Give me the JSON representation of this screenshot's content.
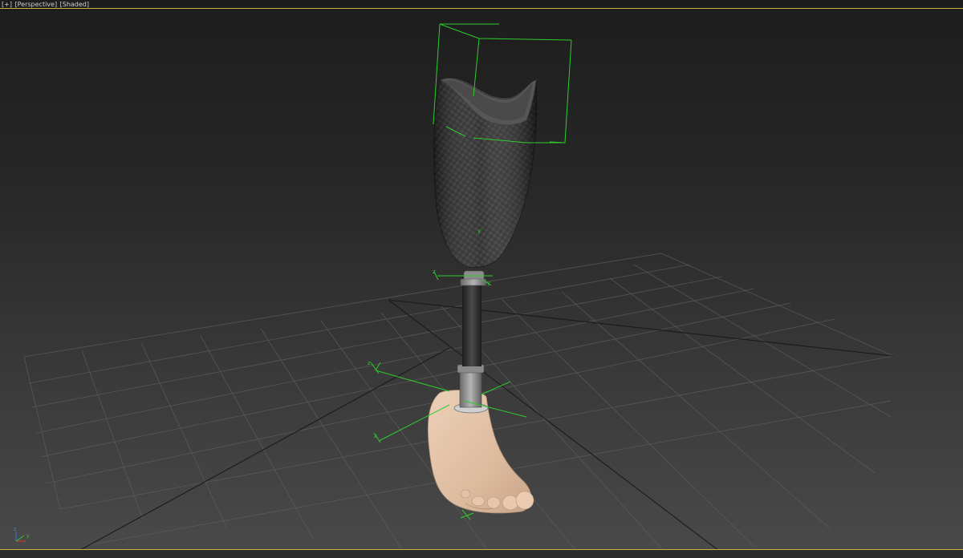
{
  "viewport": {
    "menus": {
      "general": "[+]",
      "point_of_view": "[Perspective]",
      "shading": "[Shaded]"
    },
    "gizmo_axis_labels": {
      "x": "x",
      "y": "y",
      "z": "z"
    },
    "colors": {
      "border": "#c8b23a",
      "gizmo": "#2ecc2e",
      "grid": "#5e5e5e",
      "socket": "#2f2f2f",
      "foot": "#e0bfa6"
    }
  }
}
